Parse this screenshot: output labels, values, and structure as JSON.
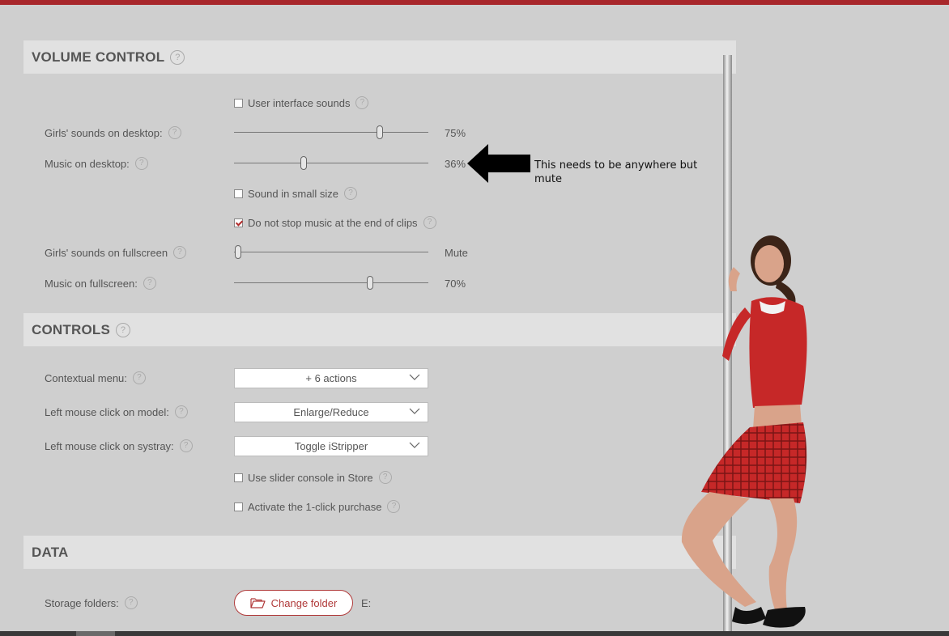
{
  "sections": {
    "volume": {
      "title": "VOLUME CONTROL"
    },
    "controls": {
      "title": "CONTROLS"
    },
    "data": {
      "title": "DATA"
    }
  },
  "help_glyph": "?",
  "volume": {
    "ui_sounds": {
      "label": "User interface sounds",
      "checked": false
    },
    "girls_desktop": {
      "label": "Girls' sounds on desktop:",
      "value_text": "75%",
      "level": 0.75
    },
    "music_desktop": {
      "label": "Music on desktop:",
      "value_text": "36%",
      "level": 0.36
    },
    "small_size": {
      "label": "Sound in small size",
      "checked": false
    },
    "no_stop_music": {
      "label": "Do not stop music at the end of clips",
      "checked": true
    },
    "girls_fullscreen": {
      "label": "Girls' sounds on fullscreen",
      "value_text": "Mute",
      "level": 0
    },
    "music_fullscreen": {
      "label": "Music on fullscreen:",
      "value_text": "70%",
      "level": 0.7
    }
  },
  "controls": {
    "contextual_menu": {
      "label": "Contextual menu:",
      "value": "+ 6 actions"
    },
    "left_click_model": {
      "label": "Left mouse click on model:",
      "value": "Enlarge/Reduce"
    },
    "left_click_systray": {
      "label": "Left mouse click on systray:",
      "value": "Toggle iStripper"
    },
    "slider_console": {
      "label": "Use slider console in Store",
      "checked": false
    },
    "one_click": {
      "label": "Activate the 1-click purchase",
      "checked": false
    }
  },
  "data": {
    "storage": {
      "label": "Storage folders:",
      "button": "Change folder",
      "drive": "E:"
    }
  },
  "annotation": {
    "text": "This needs to be anywhere but mute"
  },
  "icons": {
    "help": "question-circle-icon",
    "folder": "folder-open-icon",
    "chevron": "chevron-down-icon"
  },
  "colors": {
    "accent": "#a8272b",
    "background": "#cfcfcf",
    "header": "#e1e1e1"
  }
}
